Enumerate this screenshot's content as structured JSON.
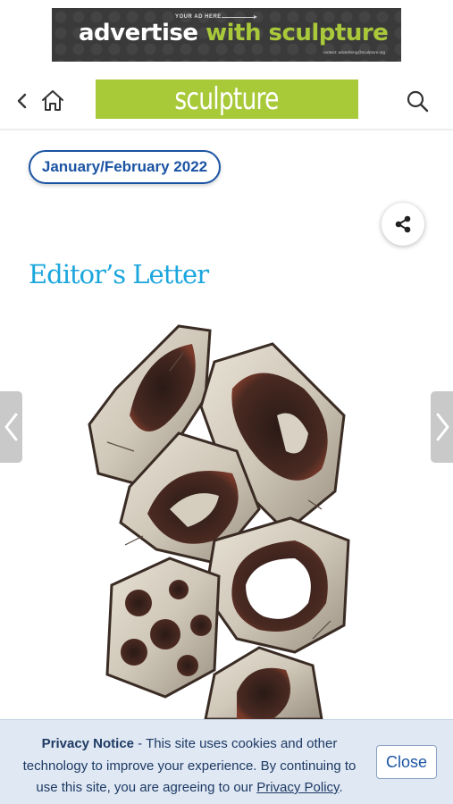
{
  "ad": {
    "small_text": "YOUR AD HERE",
    "headline_1": "advertise",
    "headline_2": "with sculpture",
    "contact": "contact: advertising@sculpture.org"
  },
  "header": {
    "logo_text": "sculpture"
  },
  "issue": {
    "label": "January/February 2022"
  },
  "article": {
    "title": "Editor’s Letter"
  },
  "privacy": {
    "heading": "Privacy Notice",
    "text_before": " - This site uses cookies and other technology to improve your experience. By continuing to use this site, you are agreeing to our ",
    "link": "Privacy Policy",
    "text_after": ".",
    "close_label": "Close"
  },
  "colors": {
    "accent_green": "#a8c938",
    "brand_blue": "#1b54a3",
    "title_blue": "#1ba6dd",
    "notice_bg": "#dfe8f3"
  },
  "icons": {
    "back": "chevron-left-icon",
    "home": "home-icon",
    "search": "search-icon",
    "share": "share-icon",
    "prev": "chevron-left-icon",
    "next": "chevron-right-icon"
  }
}
